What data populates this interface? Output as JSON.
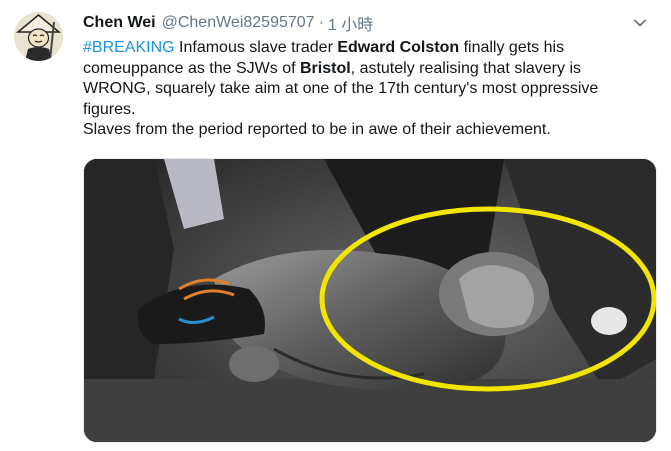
{
  "tweet": {
    "display_name": "Chen Wei",
    "handle": "@ChenWei82595707",
    "separator": "·",
    "time": "1 小時",
    "line1": {
      "hashtag": "#BREAKING",
      "part1": " Infamous slave trader ",
      "bold1": "Edward Colston",
      "part2": " finally gets his comeuppance as the SJWs of ",
      "bold2": "Bristol",
      "part3": ", astutely realising that slavery is WRONG, squarely take aim at one of the 17th century's most oppressive figures."
    },
    "line2": "Slaves from the period reported to be in awe of their achievement."
  },
  "icons": {
    "avatar": "avatar-cartoon-farmer-icon",
    "caret": "chevron-down-icon"
  },
  "colors": {
    "hashtag": "#1b95e0",
    "muted": "#657786",
    "highlight_circle": "#f2e600"
  }
}
